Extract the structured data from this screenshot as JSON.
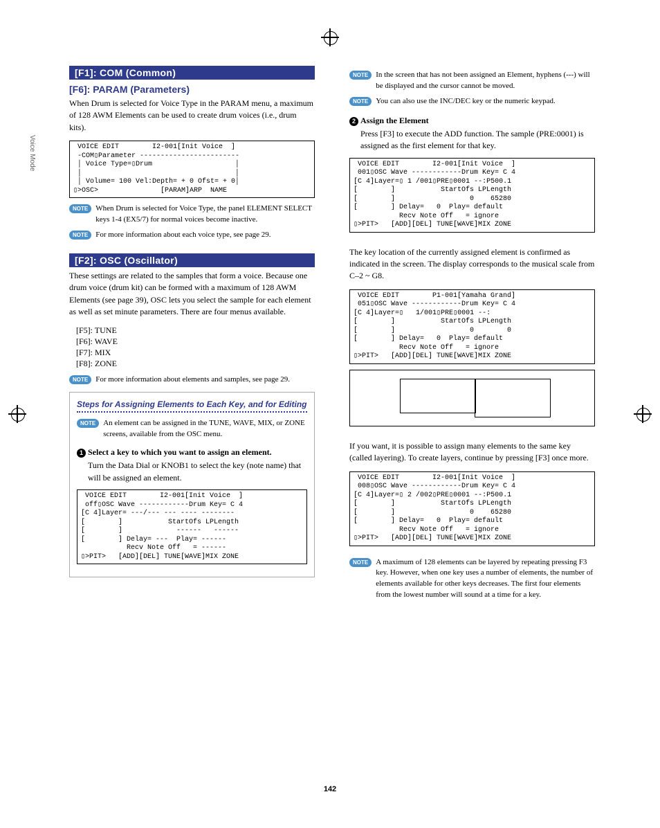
{
  "sidebar": {
    "label": "Voice Mode"
  },
  "page_number": "142",
  "left": {
    "h1": "[F1]: COM (Common)",
    "h2": "[F6]: PARAM (Parameters)",
    "p1": "When Drum is selected for Voice Type in the PARAM menu, a maximum of 128 AWM Elements can be used to create drum voices (i.e., drum kits).",
    "lcd1": " VOICE EDIT        I2-001[Init Voice  ]\n -COM▯Parameter ------------------------\n │ Voice Type=▯Drum                    │\n │                                     │\n │ Volume= 100 Vel:Depth= + 0 Ofst= + 0│\n▯>OSC>               [PARAM]ARP  NAME",
    "note1": "When Drum is selected for Voice Type, the panel ELEMENT SELECT keys 1-4 (EX5/7) for normal voices become inactive.",
    "note2": "For more information about each voice type, see page 29.",
    "h3": "[F2]: OSC (Oscillator)",
    "p2": "These settings are related to the samples that form a voice. Because one drum voice (drum kit) can be formed with a maximum of 128 AWM Elements (see page 39), OSC lets you select the sample for each element as well as set minute parameters. There are four menus available.",
    "menu": [
      "[F5]: TUNE",
      "[F6]: WAVE",
      "[F7]: MIX",
      "[F8]: ZONE"
    ],
    "note3": "For more information about elements and samples, see page 29.",
    "steps_title": "Steps for Assigning Elements to Each Key, and for Editing",
    "steps_note": "An element can be assigned in the TUNE, WAVE, MIX, or ZONE screens, available from the OSC menu.",
    "step1_head": "Select a key to which you want to assign an element.",
    "step1_body": "Turn the Data Dial or KNOB1 to select the key (note name) that will be assigned an element.",
    "lcd2": " VOICE EDIT        I2-001[Init Voice  ]\n off▯OSC Wave ------------Drum Key= C 4\n[C 4]Layer= ---/--- --- ---- --------\n[        ]           StartOfs LPLength\n[        ]             ------   ------\n[        ] Delay= ---  Play= ------\n           Recv Note Off   = ------\n▯>PIT>   [ADD][DEL] TUNE[WAVE]MIX ZONE"
  },
  "right": {
    "note1": "In the screen that has not been assigned an Element, hyphens (---) will be displayed and the cursor cannot be moved.",
    "note2": "You can also use the INC/DEC key or the numeric keypad.",
    "step2_head": "Assign the Element",
    "step2_body": "Press [F3] to execute the ADD function. The sample (PRE:0001) is assigned as the first element for that key.",
    "lcd1": " VOICE EDIT        I2-001[Init Voice  ]\n 001▯OSC Wave ------------Drum Key= C 4\n[C 4]Layer=▯ 1 /001▯PRE▯0001 --:P500.1\n[        ]           StartOfs LPLength\n[        ]                  0    65280\n[        ] Delay=   0  Play= default\n           Recv Note Off   = ignore\n▯>PIT>   [ADD][DEL] TUNE[WAVE]MIX ZONE",
    "p1": "The key location of the currently assigned element is confirmed as indicated in the screen. The display corresponds to the musical scale from C–2 ~ G8.",
    "lcd2": " VOICE EDIT        P1-001[Yamaha Grand]\n 051▯OSC Wave ------------Drum Key= C 4\n[C 4]Layer=▯   1/001▯PRE▯0001 --:\n[        ]           StartOfs LPLength\n[        ]                  0        0\n[        ] Delay=   0  Play= default\n           Recv Note Off   = ignore\n▯>PIT>   [ADD][DEL] TUNE[WAVE]MIX ZONE",
    "p2": "If you want, it is possible to assign many elements to the same key (called layering). To create layers, continue by pressing [F3] once more.",
    "lcd3": " VOICE EDIT        I2-001[Init Voice  ]\n 008▯OSC Wave ------------Drum Key= C 4\n[C 4]Layer=▯ 2 /002▯PRE▯0001 --:P500.1\n[        ]           StartOfs LPLength\n[        ]                  0    65280\n[        ] Delay=   0  Play= default\n           Recv Note Off   = ignore\n▯>PIT>   [ADD][DEL] TUNE[WAVE]MIX ZONE",
    "note3": "A maximum of 128 elements can be layered by repeating pressing F3 key. However, when one key uses a number of elements, the number of elements available for other keys decreases. The first four elements from the lowest number will sound at a time for a key."
  }
}
